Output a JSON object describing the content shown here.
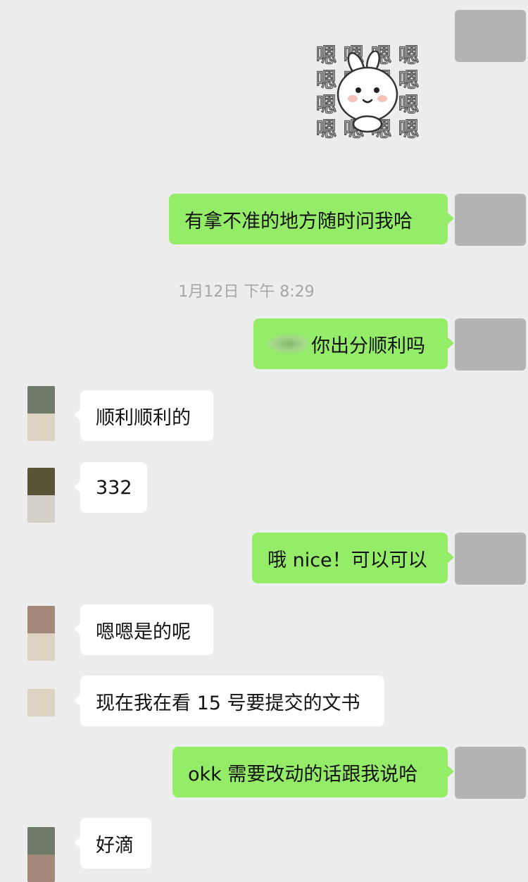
{
  "chat": {
    "sticker": {
      "glyph": "嗯",
      "icon": "bunny-sticker"
    },
    "messages": [
      {
        "text": "有拿不准的地方随时问我哈"
      },
      {
        "text": "你出分顺利吗"
      },
      {
        "text": "顺利顺利的"
      },
      {
        "text": "332"
      },
      {
        "text": "哦 nice！可以可以"
      },
      {
        "text": "嗯嗯是的呢"
      },
      {
        "text": "现在我在看 15 号要提交的文书"
      },
      {
        "text": "okk 需要改动的话跟我说哈"
      },
      {
        "text": "好滴"
      }
    ],
    "timestamp": "1月12日 下午 8:29"
  },
  "colors": {
    "background": "#ededed",
    "my_bubble": "#95ec69",
    "their_bubble": "#ffffff",
    "my_avatar": "#b3b3b3",
    "timestamp_text": "#a6a6a6"
  }
}
